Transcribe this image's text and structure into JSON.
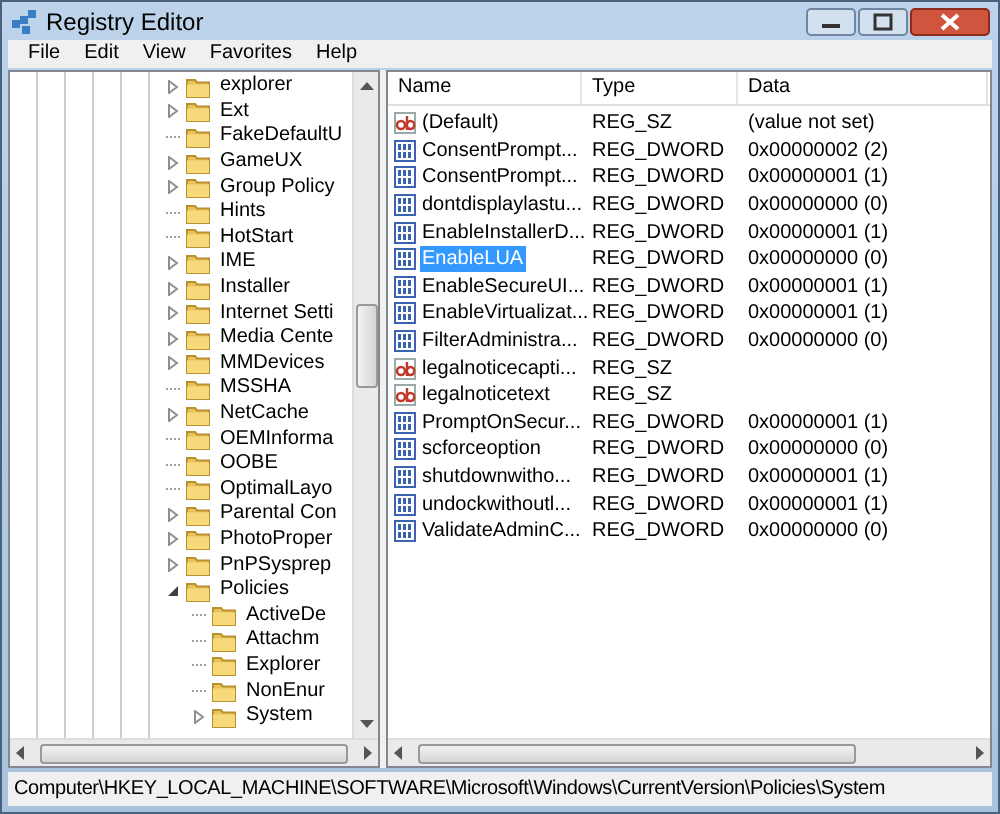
{
  "window": {
    "title": "Registry Editor"
  },
  "menu": [
    "File",
    "Edit",
    "View",
    "Favorites",
    "Help"
  ],
  "tree": [
    {
      "label": "explorer",
      "kind": "collapsed",
      "selected": false
    },
    {
      "label": "Ext",
      "kind": "collapsed",
      "selected": false
    },
    {
      "label": "FakeDefaultU",
      "kind": "leaf",
      "selected": false
    },
    {
      "label": "GameUX",
      "kind": "collapsed",
      "selected": false
    },
    {
      "label": "Group Policy",
      "kind": "collapsed",
      "selected": false
    },
    {
      "label": "Hints",
      "kind": "leaf",
      "selected": false
    },
    {
      "label": "HotStart",
      "kind": "leaf",
      "selected": false
    },
    {
      "label": "IME",
      "kind": "collapsed",
      "selected": false
    },
    {
      "label": "Installer",
      "kind": "collapsed",
      "selected": false
    },
    {
      "label": "Internet Setti",
      "kind": "collapsed",
      "selected": false
    },
    {
      "label": "Media Cente",
      "kind": "collapsed",
      "selected": false
    },
    {
      "label": "MMDevices",
      "kind": "collapsed",
      "selected": false
    },
    {
      "label": "MSSHA",
      "kind": "leaf",
      "selected": false
    },
    {
      "label": "NetCache",
      "kind": "collapsed",
      "selected": false
    },
    {
      "label": "OEMInforma",
      "kind": "leaf",
      "selected": false
    },
    {
      "label": "OOBE",
      "kind": "leaf",
      "selected": false
    },
    {
      "label": "OptimalLayo",
      "kind": "leaf",
      "selected": false
    },
    {
      "label": "Parental Con",
      "kind": "collapsed",
      "selected": false
    },
    {
      "label": "PhotoProper",
      "kind": "collapsed",
      "selected": false
    },
    {
      "label": "PnPSysprep",
      "kind": "collapsed",
      "selected": false
    },
    {
      "label": "Policies",
      "kind": "expanded",
      "selected": false,
      "children": [
        {
          "label": "ActiveDe",
          "kind": "leaf",
          "selected": false
        },
        {
          "label": "Attachm",
          "kind": "leaf",
          "selected": false
        },
        {
          "label": "Explorer",
          "kind": "leaf",
          "selected": false
        },
        {
          "label": "NonEnur",
          "kind": "leaf",
          "selected": false
        },
        {
          "label": "System",
          "kind": "collapsed",
          "selected": false
        }
      ]
    }
  ],
  "table": {
    "columns": [
      "Name",
      "Type",
      "Data"
    ],
    "rows": [
      {
        "kind": "string",
        "name": "(Default)",
        "type": "REG_SZ",
        "data": "(value not set)",
        "selected": false
      },
      {
        "kind": "dword",
        "name": "ConsentPrompt...",
        "type": "REG_DWORD",
        "data": "0x00000002 (2)",
        "selected": false
      },
      {
        "kind": "dword",
        "name": "ConsentPrompt...",
        "type": "REG_DWORD",
        "data": "0x00000001 (1)",
        "selected": false
      },
      {
        "kind": "dword",
        "name": "dontdisplaylastu...",
        "type": "REG_DWORD",
        "data": "0x00000000 (0)",
        "selected": false
      },
      {
        "kind": "dword",
        "name": "EnableInstallerD...",
        "type": "REG_DWORD",
        "data": "0x00000001 (1)",
        "selected": false
      },
      {
        "kind": "dword",
        "name": "EnableLUA",
        "type": "REG_DWORD",
        "data": "0x00000000 (0)",
        "selected": true
      },
      {
        "kind": "dword",
        "name": "EnableSecureUI...",
        "type": "REG_DWORD",
        "data": "0x00000001 (1)",
        "selected": false
      },
      {
        "kind": "dword",
        "name": "EnableVirtualizat...",
        "type": "REG_DWORD",
        "data": "0x00000001 (1)",
        "selected": false
      },
      {
        "kind": "dword",
        "name": "FilterAdministra...",
        "type": "REG_DWORD",
        "data": "0x00000000 (0)",
        "selected": false
      },
      {
        "kind": "string",
        "name": "legalnoticecapti...",
        "type": "REG_SZ",
        "selected": false
      },
      {
        "kind": "string",
        "name": "legalnoticetext",
        "type": "REG_SZ",
        "selected": false
      },
      {
        "kind": "dword",
        "name": "PromptOnSecur...",
        "type": "REG_DWORD",
        "data": "0x00000001 (1)",
        "selected": false
      },
      {
        "kind": "dword",
        "name": "scforceoption",
        "type": "REG_DWORD",
        "data": "0x00000000 (0)",
        "selected": false
      },
      {
        "kind": "dword",
        "name": "shutdownwitho...",
        "type": "REG_DWORD",
        "data": "0x00000001 (1)",
        "selected": false
      },
      {
        "kind": "dword",
        "name": "undockwithoutl...",
        "type": "REG_DWORD",
        "data": "0x00000001 (1)",
        "selected": false
      },
      {
        "kind": "dword",
        "name": "ValidateAdminC...",
        "type": "REG_DWORD",
        "data": "0x00000000 (0)",
        "selected": false
      }
    ]
  },
  "status_bar": "Computer\\HKEY_LOCAL_MACHINE\\SOFTWARE\\Microsoft\\Windows\\CurrentVersion\\Policies\\System"
}
